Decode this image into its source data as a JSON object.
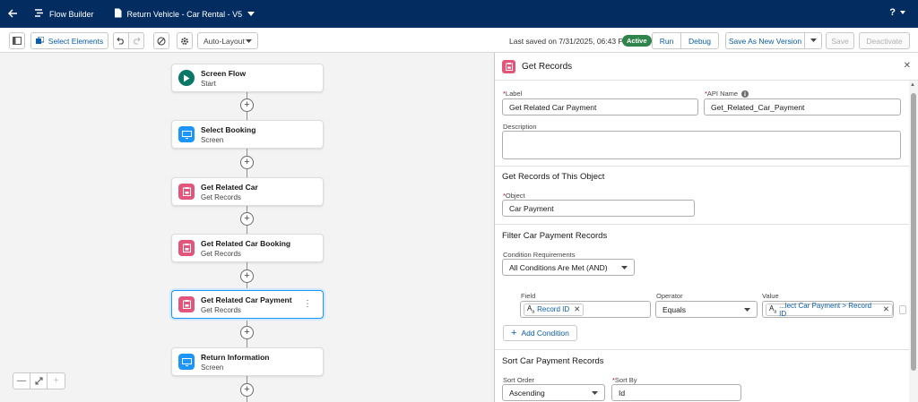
{
  "topbar": {
    "app_name": "Flow Builder",
    "flow_name": "Return Vehicle - Car Rental - V5",
    "help_label": "?"
  },
  "toolbar": {
    "select_elements_label": "Select Elements",
    "layout_select_value": "Auto-Layout",
    "last_saved": "Last saved on 7/31/2025, 06:43 PM",
    "status_badge": "Active",
    "run_label": "Run",
    "debug_label": "Debug",
    "save_as_new_label": "Save As New Version",
    "save_label": "Save",
    "deactivate_label": "Deactivate"
  },
  "canvas": {
    "nodes": [
      {
        "title": "Screen Flow",
        "subtitle": "Start",
        "icon": "play-icon"
      },
      {
        "title": "Select Booking",
        "subtitle": "Screen",
        "icon": "screen-icon"
      },
      {
        "title": "Get Related Car",
        "subtitle": "Get Records",
        "icon": "get-records-icon"
      },
      {
        "title": "Get Related Car Booking",
        "subtitle": "Get Records",
        "icon": "get-records-icon"
      },
      {
        "title": "Get Related Car Payment",
        "subtitle": "Get Records",
        "icon": "get-records-icon",
        "selected": true
      },
      {
        "title": "Return Information",
        "subtitle": "Screen",
        "icon": "screen-icon"
      }
    ]
  },
  "panel": {
    "title": "Get Records",
    "label_label": "Label",
    "label_value": "Get Related Car Payment",
    "api_name_label": "API Name",
    "api_name_value": "Get_Related_Car_Payment",
    "description_label": "Description",
    "description_value": "",
    "object_section": "Get Records of This Object",
    "object_label": "Object",
    "object_value": "Car Payment",
    "filter_section": "Filter Car Payment Records",
    "condition_req_label": "Condition Requirements",
    "condition_req_value": "All Conditions Are Met (AND)",
    "field_col": "Field",
    "operator_col": "Operator",
    "value_col": "Value",
    "condition_field": "Record ID",
    "condition_operator": "Equals",
    "condition_value": "...lect Car Payment > Record ID",
    "add_condition_label": "Add Condition",
    "sort_section": "Sort Car Payment Records",
    "sort_order_label": "Sort Order",
    "sort_order_value": "Ascending",
    "sort_by_label": "Sort By",
    "sort_by_value": "Id"
  },
  "colors": {
    "nav_bg": "#032d60",
    "brand_blue": "#0b5cab",
    "active_green": "#2e844a",
    "records_pink": "#e3557a",
    "screen_blue": "#1b96ff",
    "start_teal": "#0a7766"
  }
}
